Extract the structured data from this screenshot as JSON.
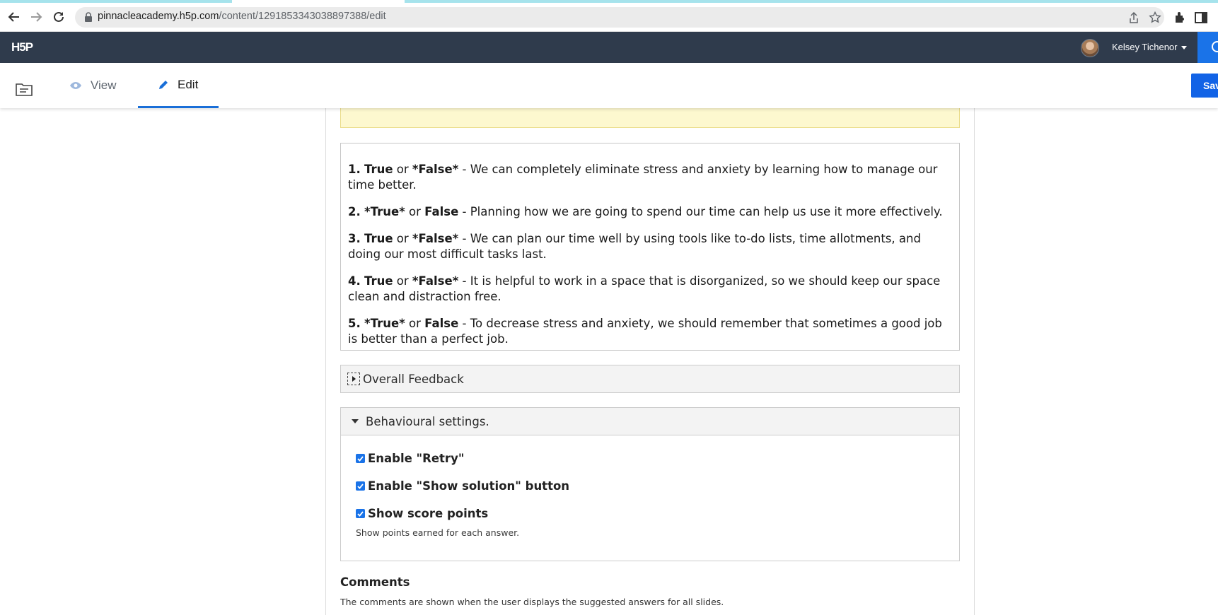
{
  "browser": {
    "url_host": "pinnacleacademy.h5p.com",
    "url_path": "/content/1291853343038897388/edit"
  },
  "header": {
    "logo": "H5P",
    "user_name": "Kelsey Tichenor"
  },
  "toolbar": {
    "view_label": "View",
    "edit_label": "Edit",
    "save_label": "Save"
  },
  "questions": [
    {
      "num": "1.",
      "first": "True",
      "or": "or",
      "second": "*False*",
      "text": " - We can completely eliminate stress and anxiety by learning how to manage our time better."
    },
    {
      "num": "2.",
      "first": "*True*",
      "or": "or",
      "second": "False",
      "text": " - Planning how we are going to spend our time can help us use it more effectively."
    },
    {
      "num": "3.",
      "first": "True",
      "or": "or",
      "second": "*False*",
      "text": " - We can plan our time well by using tools like to-do lists, time allotments, and doing our most difficult tasks last."
    },
    {
      "num": "4.",
      "first": "True",
      "or": "or",
      "second": "*False*",
      "text": " - It is helpful to work in a space that is disorganized, so we should keep our space clean and distraction free."
    },
    {
      "num": "5.",
      "first": "*True*",
      "or": "or",
      "second": "False",
      "text": " - To decrease stress and anxiety, we should remember that sometimes a good job is better than a perfect job."
    }
  ],
  "overall_feedback": {
    "label": "Overall Feedback"
  },
  "behavioural": {
    "label": "Behavioural settings.",
    "retry": {
      "label": "Enable \"Retry\"",
      "checked": true
    },
    "show_solution": {
      "label": "Enable \"Show solution\" button",
      "checked": true
    },
    "score_points": {
      "label": "Show score points",
      "checked": true,
      "description": "Show points earned for each answer."
    }
  },
  "comments": {
    "title": "Comments",
    "description": "The comments are shown when the user displays the suggested answers for all slides."
  },
  "colors": {
    "header_bg": "#2f3b4c",
    "accent_blue": "#1a73e8",
    "save_blue": "#1263e6",
    "notice_yellow": "#fdf8cf"
  }
}
